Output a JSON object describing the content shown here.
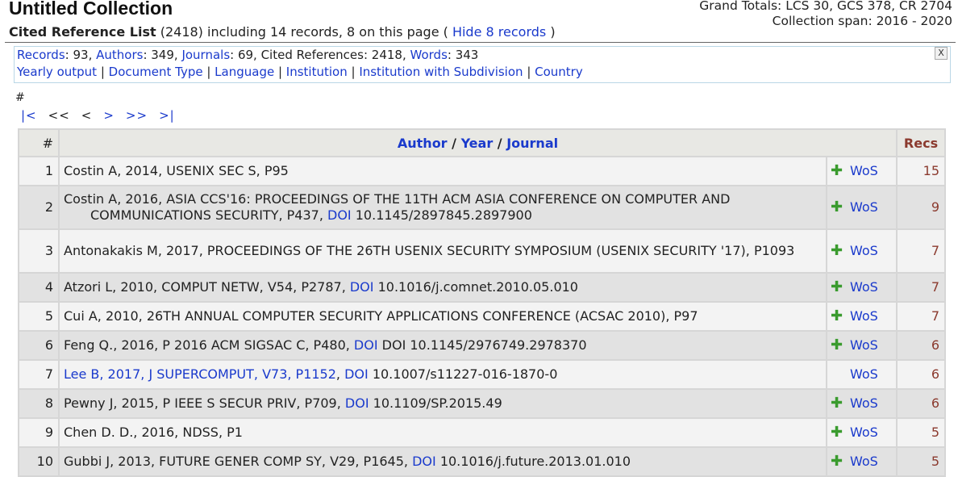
{
  "header": {
    "title": "Untitled Collection",
    "subtitle_bold": "Cited Reference List",
    "subtitle_rest": " (2418) including 14 records, 8 on this page ( ",
    "hide_link": "Hide 8 records",
    "subtitle_end": " )",
    "grand_totals": "Grand Totals: LCS 30, GCS 378, CR 2704",
    "collection_span": "Collection span: 2016 - 2020"
  },
  "summary": {
    "records_label": "Records",
    "records_value": ": 93, ",
    "authors_label": "Authors",
    "authors_value": ": 349, ",
    "journals_label": "Journals",
    "journals_value": ": 69, Cited References: 2418, ",
    "words_label": "Words",
    "words_value": ": 343",
    "links": [
      "Yearly output",
      "Document Type",
      "Language",
      "Institution",
      "Institution with Subdivision",
      "Country"
    ],
    "close": "X"
  },
  "hash_label": "#",
  "pager": {
    "first": "|<",
    "prev_page": "<<",
    "prev": "<",
    "next": ">",
    "next_page": ">>",
    "last": ">|"
  },
  "table": {
    "col_num": "#",
    "col_author": "Author",
    "col_year": "Year",
    "col_journal": "Journal",
    "col_sep": " / ",
    "col_recs": "Recs",
    "wos_label": "WoS",
    "plus_icon": "✚",
    "rows": [
      {
        "n": "1",
        "text": "Costin A, 2014, USENIX SEC S, P95",
        "doi": "",
        "doi_val": "",
        "recs": "15",
        "plus": true
      },
      {
        "n": "2",
        "text": "Costin A, 2016, ASIA CCS'16: PROCEEDINGS OF THE 11TH ACM ASIA CONFERENCE ON COMPUTER AND COMMUNICATIONS SECURITY, P437, ",
        "doi": "DOI",
        "doi_val": " 10.1145/2897845.2897900",
        "recs": "9",
        "plus": true
      },
      {
        "n": "3",
        "text": "Antonakakis M, 2017, PROCEEDINGS OF THE 26TH USENIX SECURITY SYMPOSIUM (USENIX SECURITY '17), P1093",
        "doi": "",
        "doi_val": "",
        "recs": "7",
        "plus": true
      },
      {
        "n": "4",
        "text": "Atzori L, 2010, COMPUT NETW, V54, P2787, ",
        "doi": "DOI",
        "doi_val": " 10.1016/j.comnet.2010.05.010",
        "recs": "7",
        "plus": true
      },
      {
        "n": "5",
        "text": "Cui A, 2010, 26TH ANNUAL COMPUTER SECURITY APPLICATIONS CONFERENCE (ACSAC 2010), P97",
        "doi": "",
        "doi_val": "",
        "recs": "7",
        "plus": true
      },
      {
        "n": "6",
        "text": "Feng Q., 2016, P 2016 ACM SIGSAC C, P480, ",
        "doi": "DOI",
        "doi_val": " DOI 10.1145/2976749.2978370",
        "recs": "6",
        "plus": true
      },
      {
        "n": "7",
        "text_link": "Lee B, 2017, J SUPERCOMPUT, V73, P1152",
        "text": ", ",
        "doi": "DOI",
        "doi_val": " 10.1007/s11227-016-1870-0",
        "recs": "6",
        "plus": false
      },
      {
        "n": "8",
        "text": "Pewny J, 2015, P IEEE S SECUR PRIV, P709, ",
        "doi": "DOI",
        "doi_val": " 10.1109/SP.2015.49",
        "recs": "6",
        "plus": true
      },
      {
        "n": "9",
        "text": "Chen D. D., 2016, NDSS, P1",
        "doi": "",
        "doi_val": "",
        "recs": "5",
        "plus": true
      },
      {
        "n": "10",
        "text": "Gubbi J, 2013, FUTURE GENER COMP SY, V29, P1645, ",
        "doi": "DOI",
        "doi_val": " 10.1016/j.future.2013.01.010",
        "recs": "5",
        "plus": true
      }
    ]
  }
}
